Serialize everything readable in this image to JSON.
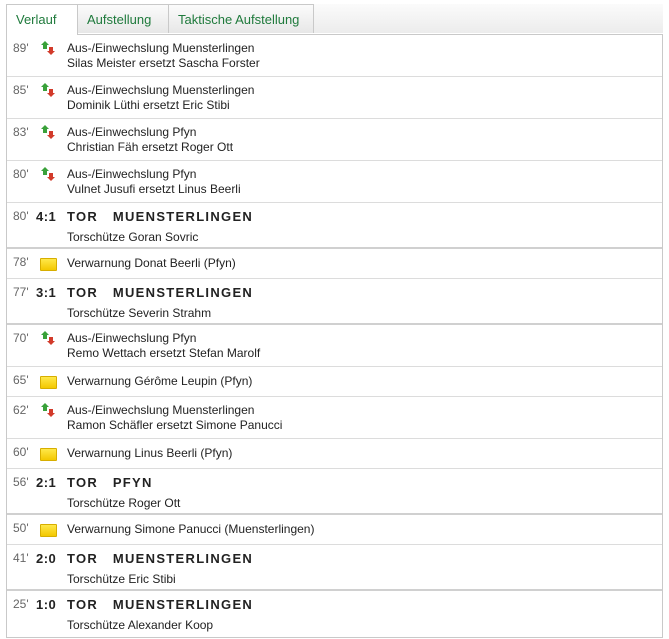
{
  "tabs": [
    {
      "label": "Verlauf",
      "active": true
    },
    {
      "label": "Aufstellung",
      "active": false
    },
    {
      "label": "Taktische Aufstellung",
      "active": false
    }
  ],
  "colors": {
    "tab_text": "#1f7a3c",
    "card_yellow": "#f3c800",
    "border": "#c9c9c9"
  },
  "events": [
    {
      "type": "sub",
      "minute": "89'",
      "line1": "Aus-/Einwechslung Muensterlingen",
      "line2": "Silas Meister ersetzt Sascha Forster",
      "icon": "substitution-icon"
    },
    {
      "type": "sub",
      "minute": "85'",
      "line1": "Aus-/Einwechslung Muensterlingen",
      "line2": "Dominik Lüthi ersetzt Eric Stibi",
      "icon": "substitution-icon"
    },
    {
      "type": "sub",
      "minute": "83'",
      "line1": "Aus-/Einwechslung Pfyn",
      "line2": "Christian Fäh ersetzt Roger Ott",
      "icon": "substitution-icon"
    },
    {
      "type": "sub",
      "minute": "80'",
      "line1": "Aus-/Einwechslung Pfyn",
      "line2": "Vulnet Jusufi ersetzt Linus Beerli",
      "icon": "substitution-icon"
    },
    {
      "type": "goal",
      "minute": "80'",
      "score": "4:1",
      "title": "TOR   MUENSTERLINGEN",
      "line2": "Torschütze Goran Sovric"
    },
    {
      "type": "card",
      "minute": "78'",
      "line1": "Verwarnung Donat Beerli (Pfyn)",
      "icon": "yellow-card-icon"
    },
    {
      "type": "goal",
      "minute": "77'",
      "score": "3:1",
      "title": "TOR   MUENSTERLINGEN",
      "line2": "Torschütze Severin Strahm"
    },
    {
      "type": "sub",
      "minute": "70'",
      "line1": "Aus-/Einwechslung Pfyn",
      "line2": "Remo Wettach ersetzt Stefan Marolf",
      "icon": "substitution-icon"
    },
    {
      "type": "card",
      "minute": "65'",
      "line1": "Verwarnung Gérôme Leupin (Pfyn)",
      "icon": "yellow-card-icon"
    },
    {
      "type": "sub",
      "minute": "62'",
      "line1": "Aus-/Einwechslung Muensterlingen",
      "line2": "Ramon Schäfler ersetzt Simone Panucci",
      "icon": "substitution-icon"
    },
    {
      "type": "card",
      "minute": "60'",
      "line1": "Verwarnung Linus Beerli (Pfyn)",
      "icon": "yellow-card-icon"
    },
    {
      "type": "goal",
      "minute": "56'",
      "score": "2:1",
      "title": "TOR   PFYN",
      "line2": "Torschütze Roger Ott"
    },
    {
      "type": "card",
      "minute": "50'",
      "line1": "Verwarnung Simone Panucci (Muensterlingen)",
      "icon": "yellow-card-icon"
    },
    {
      "type": "goal",
      "minute": "41'",
      "score": "2:0",
      "title": "TOR   MUENSTERLINGEN",
      "line2": "Torschütze Eric Stibi"
    },
    {
      "type": "goal",
      "minute": "25'",
      "score": "1:0",
      "title": "TOR   MUENSTERLINGEN",
      "line2": "Torschütze Alexander Koop"
    }
  ]
}
